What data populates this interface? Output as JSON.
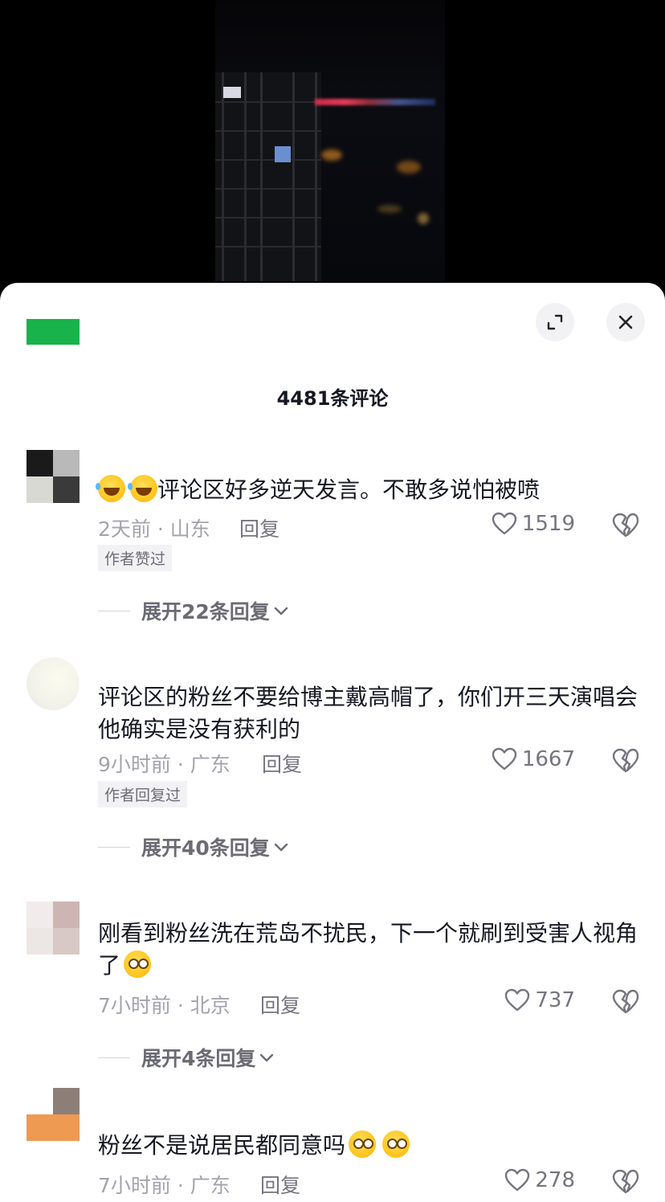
{
  "panel": {
    "comment_count_title": "4481条评论"
  },
  "icons": {
    "expand": "expand-icon",
    "close": "close-icon",
    "like": "heart-outline-icon",
    "dislike": "broken-heart-icon"
  },
  "colors": {
    "tag_green": "#18b34a",
    "text_primary": "#161823",
    "text_secondary": "#a3a3ad"
  },
  "comments": [
    {
      "text": "评论区好多逆天发言。不敢多说怕被喷",
      "emoji_prefix": [
        "laugh-cry-emoji",
        "laugh-cry-emoji"
      ],
      "time_location": "2天前 · 山东",
      "reply_label": "回复",
      "likes": "1519",
      "badge": "作者赞过",
      "expand_label": "展开22条回复"
    },
    {
      "text": "评论区的粉丝不要给博主戴高帽了，你们开三天演唱会他确实是没有获利的",
      "time_location": "9小时前 · 广东",
      "reply_label": "回复",
      "likes": "1667",
      "badge": "作者回复过",
      "expand_label": "展开40条回复"
    },
    {
      "text": "刚看到粉丝洗在荒岛不扰民，下一个就刷到受害人视角了",
      "emoji_suffix": [
        "doge-emoji"
      ],
      "time_location": "7小时前 · 北京",
      "reply_label": "回复",
      "likes": "737",
      "expand_label": "展开4条回复"
    },
    {
      "text": "粉丝不是说居民都同意吗",
      "emoji_suffix": [
        "doge-emoji",
        "doge-emoji"
      ],
      "time_location": "7小时前 · 广东",
      "reply_label": "回复",
      "likes": "278"
    }
  ]
}
